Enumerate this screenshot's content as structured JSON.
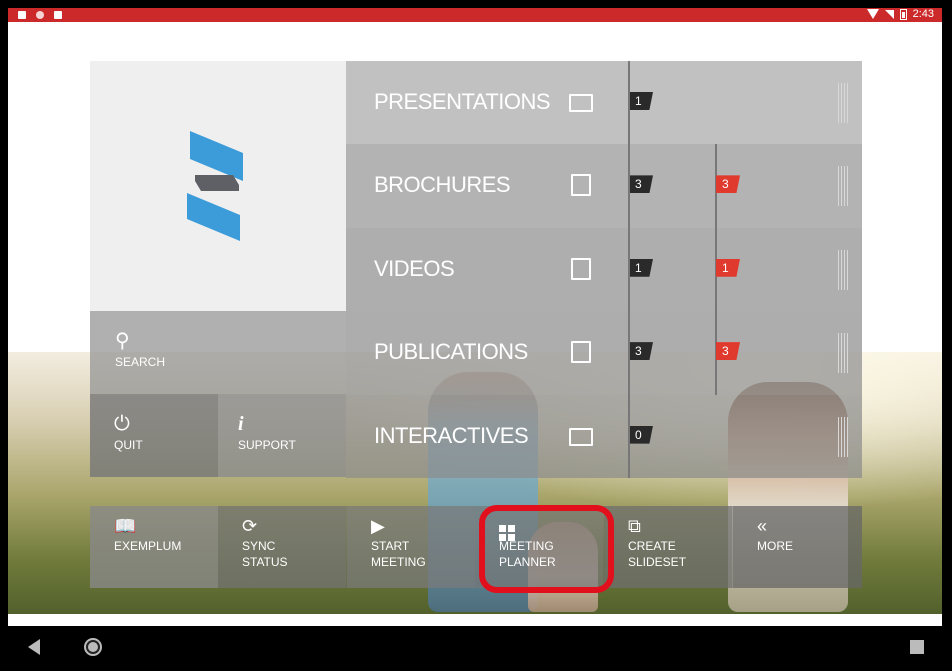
{
  "statusbar": {
    "time": "2:43"
  },
  "left_panel": {
    "search_label": "SEARCH",
    "quit_label": "QUIT",
    "support_label": "SUPPORT"
  },
  "categories": [
    {
      "label": "PRESENTATIONS",
      "icon": "presentation-icon",
      "dark_count": "1",
      "red_count": ""
    },
    {
      "label": "BROCHURES",
      "icon": "document-icon",
      "dark_count": "3",
      "red_count": "3"
    },
    {
      "label": "VIDEOS",
      "icon": "film-icon",
      "dark_count": "1",
      "red_count": "1"
    },
    {
      "label": "PUBLICATIONS",
      "icon": "document-icon",
      "dark_count": "3",
      "red_count": "3"
    },
    {
      "label": "INTERACTIVES",
      "icon": "box-icon",
      "dark_count": "0",
      "red_count": ""
    }
  ],
  "toolbar": {
    "exemplum": "EXEMPLUM",
    "sync_status": "SYNC STATUS",
    "start_meeting_1": "START",
    "start_meeting_2": "MEETING",
    "meeting_planner_1": "MEETING",
    "meeting_planner_2": "PLANNER",
    "create_slideset_1": "CREATE",
    "create_slideset_2": "SLIDESET",
    "more": "MORE"
  },
  "colors": {
    "accent_red": "#e03a2e",
    "status_red": "#cc2a2a",
    "logo_blue": "#3c9bd9",
    "highlight": "#e2101c"
  }
}
